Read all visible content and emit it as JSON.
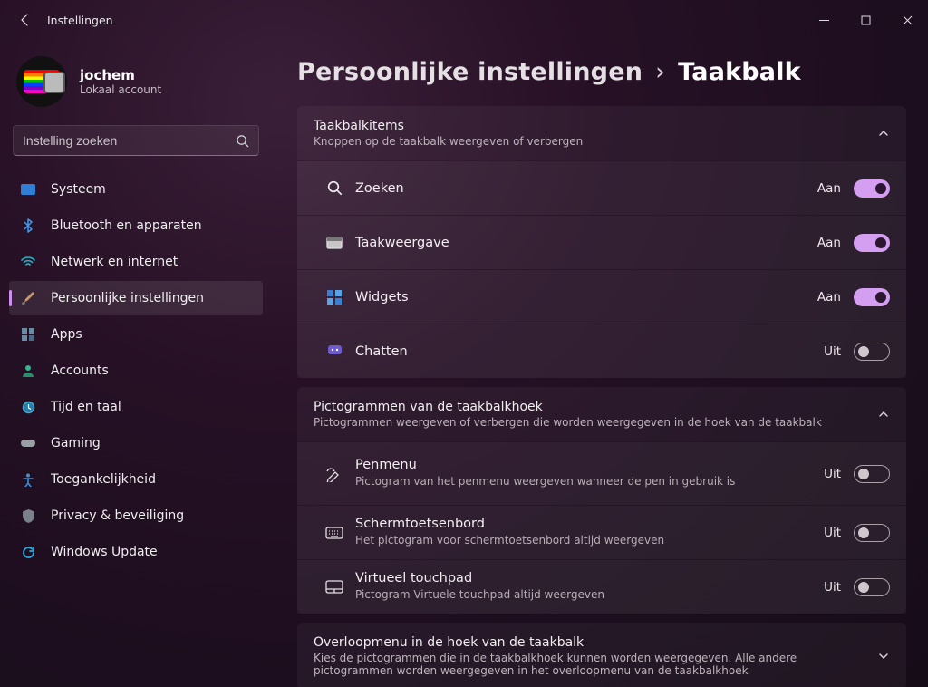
{
  "app": {
    "title": "Instellingen"
  },
  "user": {
    "name": "jochem",
    "sub": "Lokaal account"
  },
  "search": {
    "placeholder": "Instelling zoeken"
  },
  "nav": {
    "items": [
      {
        "label": "Systeem"
      },
      {
        "label": "Bluetooth en apparaten"
      },
      {
        "label": "Netwerk en internet"
      },
      {
        "label": "Persoonlijke instellingen"
      },
      {
        "label": "Apps"
      },
      {
        "label": "Accounts"
      },
      {
        "label": "Tijd en taal"
      },
      {
        "label": "Gaming"
      },
      {
        "label": "Toegankelijkheid"
      },
      {
        "label": "Privacy & beveiliging"
      },
      {
        "label": "Windows Update"
      }
    ],
    "active_index": 3
  },
  "breadcrumb": {
    "parent": "Persoonlijke instellingen",
    "sep": "›",
    "current": "Taakbalk"
  },
  "labels": {
    "on": "Aan",
    "off": "Uit"
  },
  "sections": [
    {
      "title": "Taakbalkitems",
      "sub": "Knoppen op de taakbalk weergeven of verbergen",
      "expanded": true,
      "rows": [
        {
          "label": "Zoeken",
          "state": "on"
        },
        {
          "label": "Taakweergave",
          "state": "on"
        },
        {
          "label": "Widgets",
          "state": "on"
        },
        {
          "label": "Chatten",
          "state": "off"
        }
      ]
    },
    {
      "title": "Pictogrammen van de taakbalkhoek",
      "sub": "Pictogrammen weergeven of verbergen die worden weergegeven in de hoek van de taakbalk",
      "expanded": true,
      "rows": [
        {
          "label": "Penmenu",
          "sub": "Pictogram van het penmenu weergeven wanneer de pen in gebruik is",
          "state": "off"
        },
        {
          "label": "Schermtoetsenbord",
          "sub": "Het pictogram voor schermtoetsenbord altijd weergeven",
          "state": "off"
        },
        {
          "label": "Virtueel touchpad",
          "sub": "Pictogram Virtuele touchpad altijd weergeven",
          "state": "off"
        }
      ]
    },
    {
      "title": "Overloopmenu in de hoek van de taakbalk",
      "sub": "Kies de pictogrammen die in de taakbalkhoek kunnen worden weergegeven. Alle andere pictogrammen worden weergegeven in het overloopmenu van de taakbalkhoek",
      "expanded": false
    }
  ]
}
